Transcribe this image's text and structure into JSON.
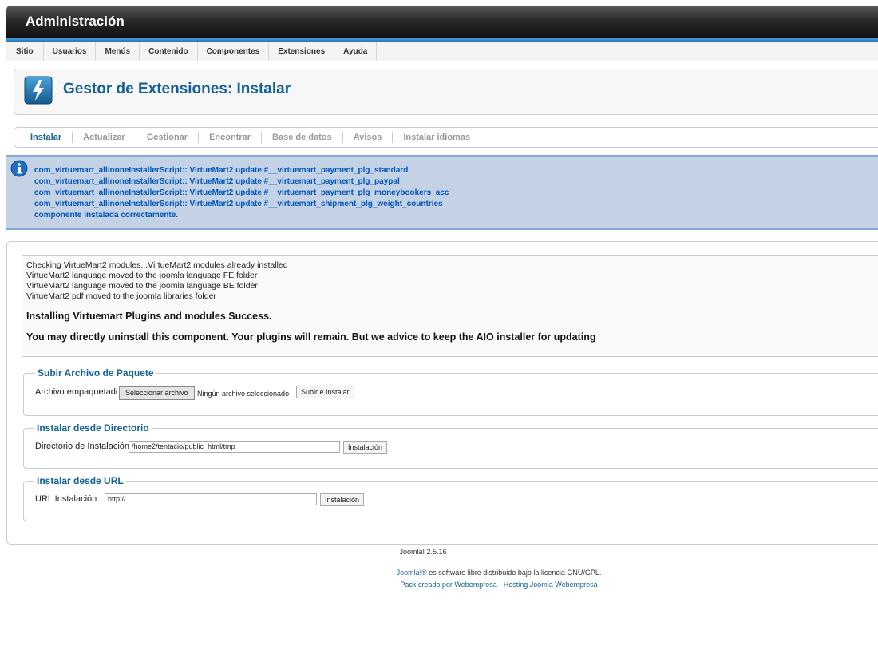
{
  "header": {
    "title": "Administración"
  },
  "menu": {
    "items": [
      "Sitio",
      "Usuarios",
      "Menús",
      "Contenido",
      "Componentes",
      "Extensiones",
      "Ayuda"
    ]
  },
  "page": {
    "title": "Gestor de Extensiones: Instalar"
  },
  "subnav": {
    "tabs": [
      "Instalar",
      "Actualizar",
      "Gestionar",
      "Encontrar",
      "Base de datos",
      "Avisos",
      "Instalar idiomas"
    ],
    "active": "Instalar"
  },
  "messages": [
    "com_virtuemart_allinoneInstallerScript:: VirtueMart2 update #__virtuemart_payment_plg_standard",
    "com_virtuemart_allinoneInstallerScript:: VirtueMart2 update #__virtuemart_payment_plg_paypal",
    "com_virtuemart_allinoneInstallerScript:: VirtueMart2 update #__virtuemart_payment_plg_moneybookers_acc",
    "com_virtuemart_allinoneInstallerScript:: VirtueMart2 update #__virtuemart_shipment_plg_weight_countries",
    "componente instalada correctamente."
  ],
  "log": {
    "lines": [
      "Checking VirtueMart2 modules...VirtueMart2 modules already installed",
      "VirtueMart2 language moved to the joomla language FE folder",
      "VirtueMart2 language moved to the joomla language BE folder",
      "VirtueMart2 pdf moved to the joomla libraries folder"
    ],
    "success": "Installing Virtuemart Plugins and modules Success.",
    "notice": "You may directly uninstall this component. Your plugins will remain. But we advice to keep the AIO installer for updating"
  },
  "upload": {
    "legend": "Subir Archivo de Paquete",
    "label": "Archivo empaquetado",
    "choose_button": "Seleccionar archivo",
    "no_file": "Ningún archivo seleccionado",
    "submit_button": "Subir e Instalar"
  },
  "directory": {
    "legend": "Instalar desde Directorio",
    "label": "Directorio de Instalación",
    "value": "/home2/tentacio/public_html/tmp",
    "button": "Instalación"
  },
  "url": {
    "legend": "Instalar desde URL",
    "label": "URL Instalación",
    "value": "http://",
    "button": "Instalación"
  },
  "footer": {
    "version": "Joomla! 2.5.16",
    "license_link": "Joomla!®",
    "license_text": " es software libre distribuido bajo la licencia GNU/GPL.",
    "pack_link": "Pack creado por Webempresa",
    "separator": " - ",
    "hosting_link": "Hosting Joomla Webempresa"
  },
  "colors": {
    "accent": "#146295",
    "message_bg": "#c3d2e5",
    "message_text": "#0055bb"
  }
}
